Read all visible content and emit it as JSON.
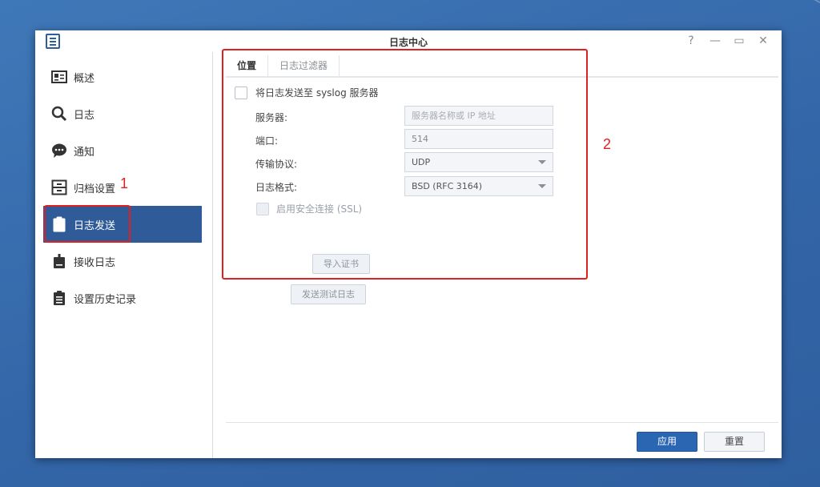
{
  "window": {
    "title": "日志中心"
  },
  "window_controls": {
    "help": "?",
    "minimize": "—",
    "maximize": "▭",
    "close": "✕"
  },
  "sidebar": {
    "items": [
      {
        "label": "概述",
        "icon": "overview-card-icon"
      },
      {
        "label": "日志",
        "icon": "search-icon"
      },
      {
        "label": "通知",
        "icon": "chat-bubble-icon"
      },
      {
        "label": "归档设置",
        "icon": "archive-cabinet-icon"
      },
      {
        "label": "日志发送",
        "icon": "clipboard-upload-icon",
        "active": true
      },
      {
        "label": "接收日志",
        "icon": "clipboard-download-icon"
      },
      {
        "label": "设置历史记录",
        "icon": "clipboard-list-icon"
      }
    ]
  },
  "annotations": {
    "marker1": "1",
    "marker2": "2",
    "color": "#e02020"
  },
  "tabs": [
    {
      "label": "位置",
      "active": true
    },
    {
      "label": "日志过滤器",
      "active": false
    }
  ],
  "form": {
    "send_checkbox_label": "将日志发送至 syslog 服务器",
    "server_label": "服务器:",
    "server_placeholder": "服务器名称或 IP 地址",
    "port_label": "端口:",
    "port_value": "514",
    "protocol_label": "传输协议:",
    "protocol_value": "UDP",
    "format_label": "日志格式:",
    "format_value": "BSD (RFC 3164)",
    "ssl_label": "启用安全连接 (SSL)",
    "import_cert_button": "导入证书",
    "send_test_button": "发送测试日志"
  },
  "footer": {
    "apply_button": "应用",
    "reset_button": "重置"
  },
  "colors": {
    "accent": "#2f5c98",
    "primary_button": "#2b66b3",
    "desktop": "#3366a8"
  }
}
